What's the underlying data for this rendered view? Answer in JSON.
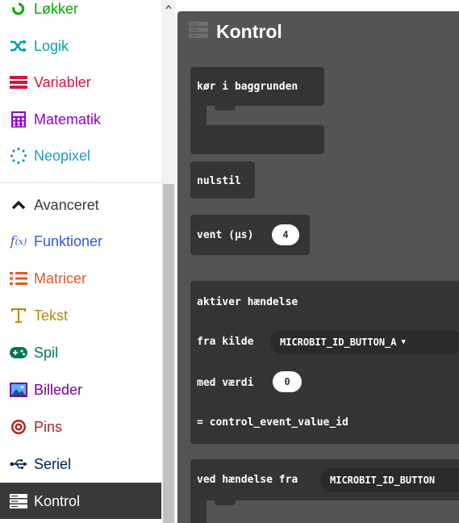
{
  "toolbox": {
    "items": [
      {
        "label": "Løkker",
        "color": "#00AA00",
        "icon": "loop-icon"
      },
      {
        "label": "Logik",
        "color": "#00A4A6",
        "icon": "logic-shuffle-icon"
      },
      {
        "label": "Variabler",
        "color": "#DC143C",
        "icon": "variables-icon"
      },
      {
        "label": "Matematik",
        "color": "#9400D3",
        "icon": "calculator-icon"
      },
      {
        "label": "Neopixel",
        "color": "#2699BF",
        "icon": "neopixel-icon"
      },
      {
        "label": "Avanceret",
        "color": "#3C3C3C",
        "icon": "chevron-up-icon"
      },
      {
        "label": "Funktioner",
        "color": "#3455DB",
        "icon": "function-icon"
      },
      {
        "label": "Matricer",
        "color": "#E65722",
        "icon": "array-list-icon"
      },
      {
        "label": "Tekst",
        "color": "#B8860B",
        "icon": "text-icon"
      },
      {
        "label": "Spil",
        "color": "#007A4B",
        "icon": "gamepad-icon"
      },
      {
        "label": "Billeder",
        "color": "#7600A8",
        "icon": "image-icon"
      },
      {
        "label": "Pins",
        "color": "#B22222",
        "icon": "pins-target-icon"
      },
      {
        "label": "Seriel",
        "color": "#002050",
        "icon": "usb-icon"
      },
      {
        "label": "Kontrol",
        "color": "#FFFFFF",
        "icon": "control-icon",
        "selected": true
      }
    ]
  },
  "flyout": {
    "title": "Kontrol",
    "background": "#545454",
    "block_color": "#343434",
    "blocks": {
      "run_background": {
        "label": "kør i baggrunden"
      },
      "reset": {
        "label": "nulstil"
      },
      "wait": {
        "label": "vent (µs)",
        "value": "4"
      },
      "raise_event": {
        "label": "aktiver hændelse",
        "source_label": "fra kilde",
        "source_value": "MICROBIT_ID_BUTTON_A",
        "value_label": "med værdi",
        "value_value": "0",
        "value_option": "= control_event_value_id"
      },
      "on_event": {
        "label": "ved hændelse fra",
        "source_value": "MICROBIT_ID_BUTTON"
      }
    }
  }
}
